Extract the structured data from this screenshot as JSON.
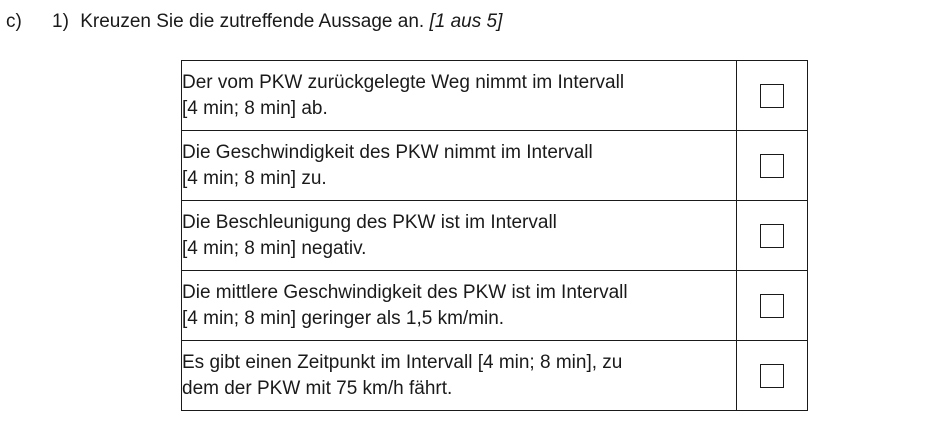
{
  "header": {
    "part_label": "c)",
    "sub_label": "1)",
    "instruction": "Kreuzen Sie die zutreffende Aussage an.",
    "hint": "[1 aus 5]"
  },
  "statements": [
    {
      "line1": "Der vom PKW zurückgelegte Weg nimmt im Intervall",
      "line2": "[4 min; 8 min] ab."
    },
    {
      "line1": "Die Geschwindigkeit des PKW nimmt im Intervall",
      "line2": "[4 min; 8 min] zu."
    },
    {
      "line1": "Die Beschleunigung des PKW ist im Intervall",
      "line2": "[4 min; 8 min] negativ."
    },
    {
      "line1": "Die mittlere Geschwindigkeit des PKW ist im Intervall",
      "line2": "[4 min; 8 min] geringer als 1,5 km/min."
    },
    {
      "line1": "Es gibt einen Zeitpunkt im Intervall [4 min; 8 min], zu",
      "line2": "dem der PKW mit 75 km/h fährt."
    }
  ]
}
